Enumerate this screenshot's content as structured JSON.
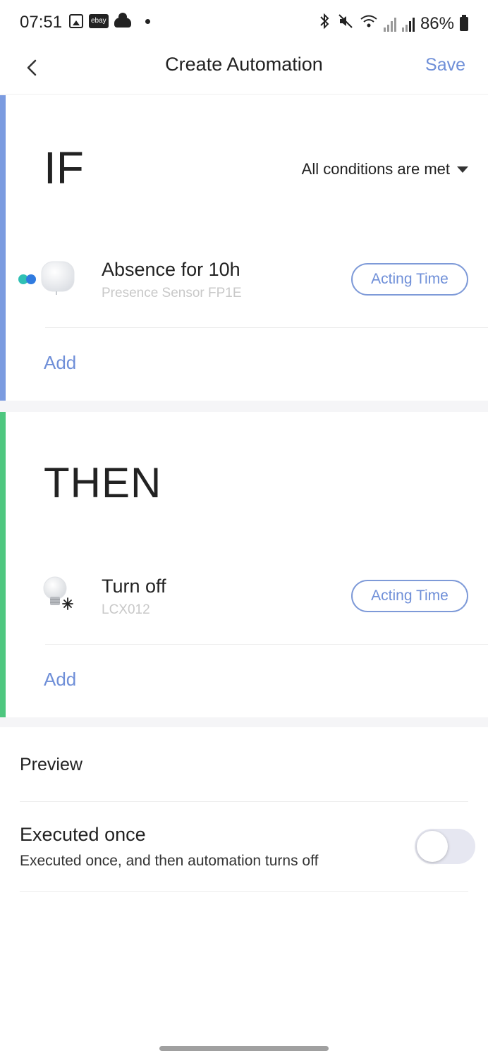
{
  "status_bar": {
    "time": "07:51",
    "ebay_label": "ebay",
    "battery": "86%"
  },
  "header": {
    "title": "Create Automation",
    "save_label": "Save"
  },
  "if_section": {
    "heading": "IF",
    "condition_mode": "All conditions are met",
    "accent_color": "#7b9be0",
    "items": [
      {
        "title": "Absence for 10h",
        "subtitle": "Presence Sensor FP1E",
        "button": "Acting Time",
        "icon": "presence-sensor-icon"
      }
    ],
    "add_label": "Add"
  },
  "then_section": {
    "heading": "THEN",
    "accent_color": "#4ec77f",
    "items": [
      {
        "title": "Turn off",
        "subtitle": "LCX012",
        "button": "Acting Time",
        "icon": "light-bulb-icon"
      }
    ],
    "add_label": "Add"
  },
  "settings": {
    "preview_label": "Preview",
    "executed_once_title": "Executed once",
    "executed_once_desc": "Executed once, and then automation turns off",
    "executed_once_enabled": false
  },
  "colors": {
    "accent_link": "#6f8fd8",
    "pair_dot_teal": "#2fc0b4",
    "pair_dot_blue": "#2f7be0"
  }
}
